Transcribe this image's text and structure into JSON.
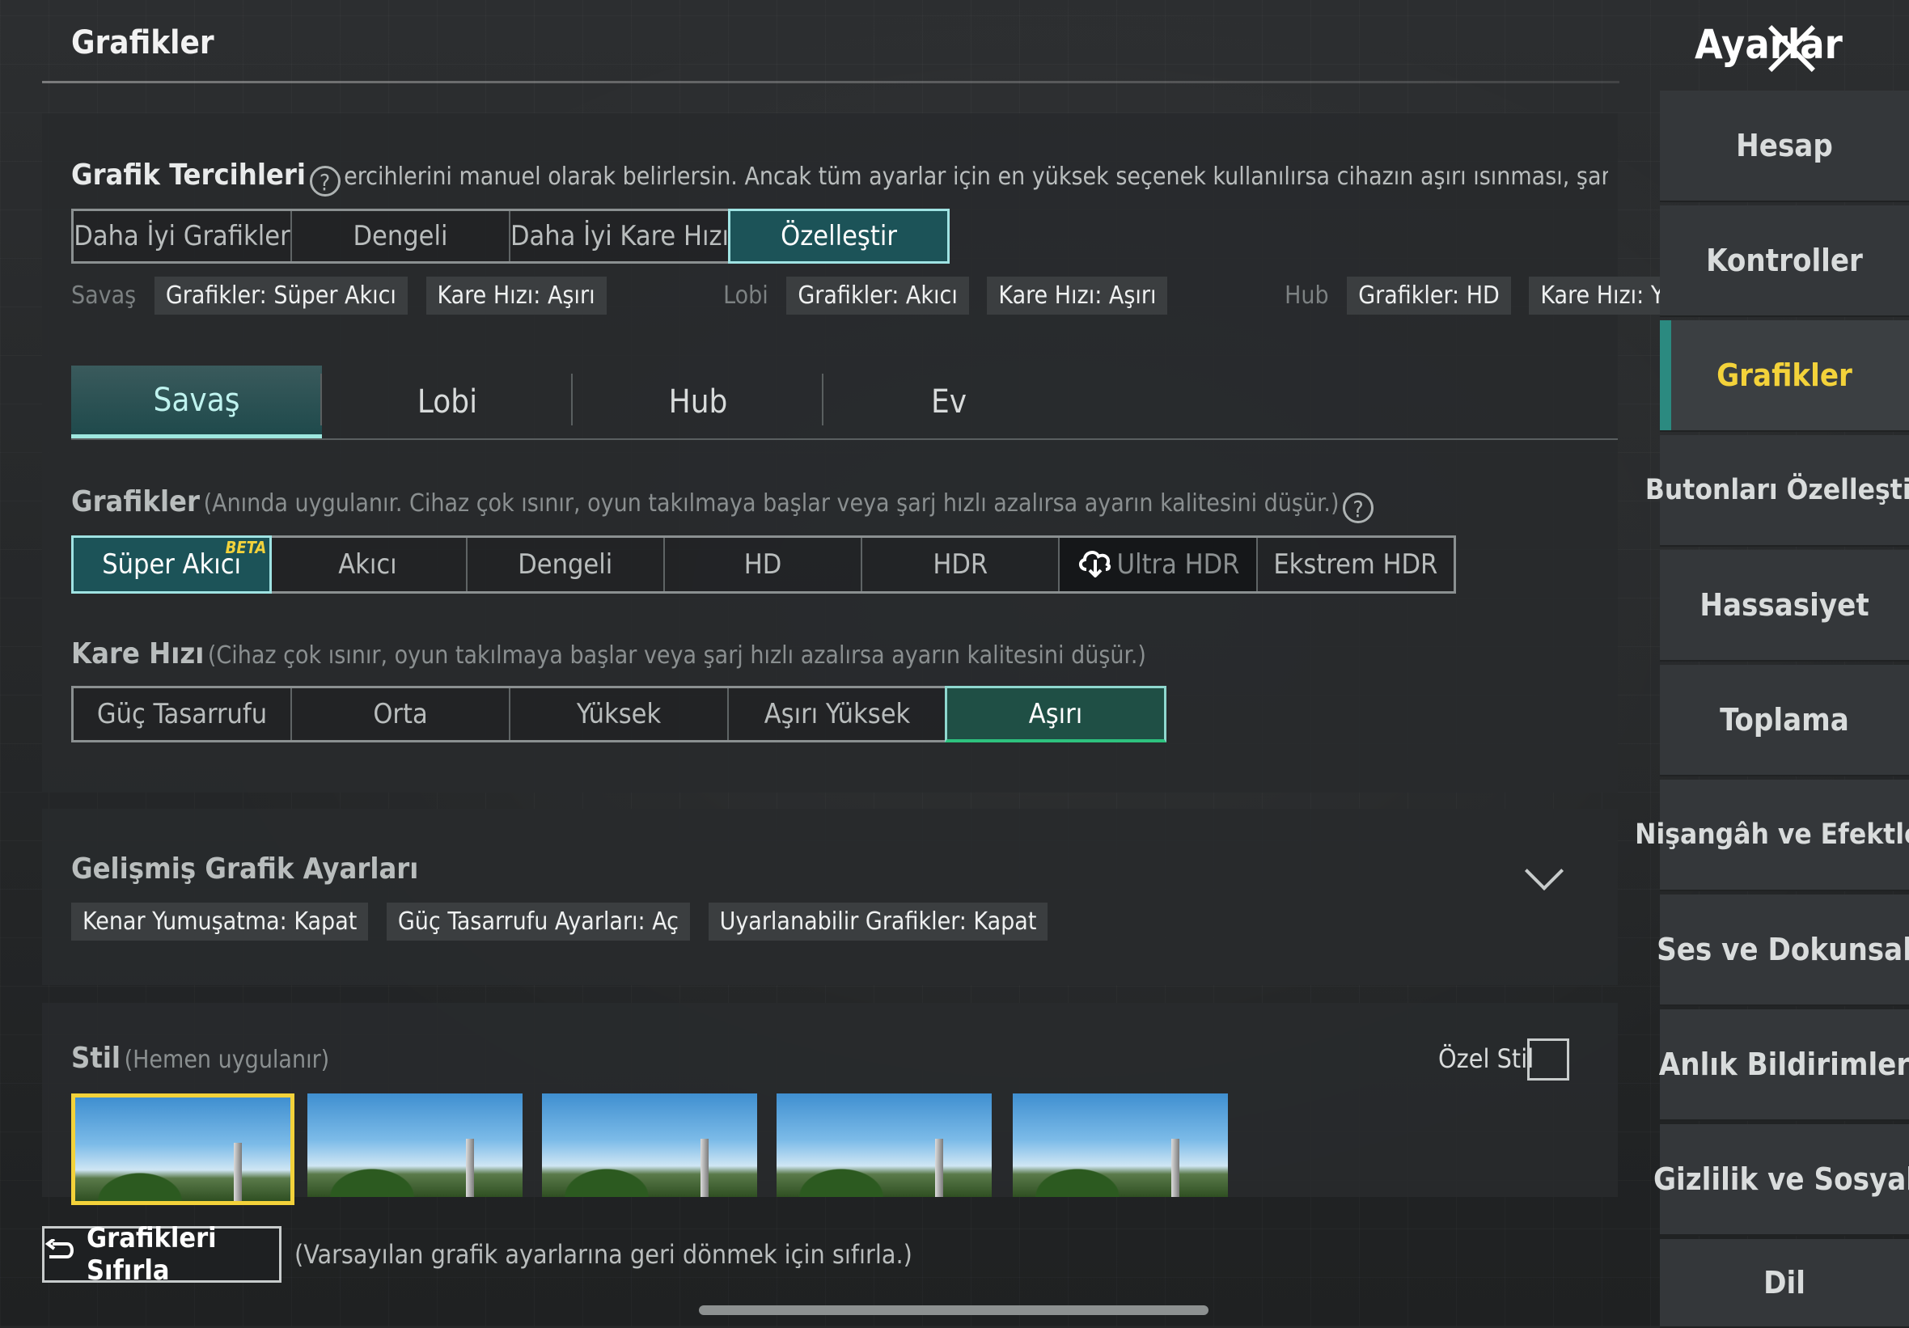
{
  "header": {
    "title": "Grafikler",
    "settings_title": "Ayarlar"
  },
  "preferences": {
    "label": "Grafik Tercihleri",
    "description": "ercihlerini manuel olarak belirlersin. Ancak tüm ayarlar için en yüksek seçenek kullanılırsa cihazın aşırı ısınması, şarj tüketiminin artma",
    "options": [
      "Daha İyi Grafikler",
      "Dengeli",
      "Daha İyi Kare Hızı",
      "Özelleştir"
    ],
    "selected": "Özelleştir",
    "summary": [
      {
        "label": "Savaş",
        "chips": [
          "Grafikler: Süper Akıcı",
          "Kare Hızı: Aşırı"
        ]
      },
      {
        "label": "Lobi",
        "chips": [
          "Grafikler: Akıcı",
          "Kare Hızı: Aşırı"
        ]
      },
      {
        "label": "Hub",
        "chips": [
          "Grafikler: HD",
          "Kare Hızı: Yüksek"
        ]
      }
    ]
  },
  "tabs": [
    "Savaş",
    "Lobi",
    "Hub",
    "Ev"
  ],
  "graphics": {
    "label": "Grafikler",
    "note": "(Anında uygulanır. Cihaz çok ısınır, oyun takılmaya başlar veya şarj hızlı azalırsa ayarın kalitesini düşür.)",
    "options": [
      "Süper Akıcı",
      "Akıcı",
      "Dengeli",
      "HD",
      "HDR",
      "Ultra HDR",
      "Ekstrem HDR"
    ],
    "beta_badge": "BETA"
  },
  "frame_rate": {
    "label": "Kare Hızı",
    "note": "(Cihaz çok ısınır, oyun takılmaya başlar veya şarj hızlı azalırsa ayarın kalitesini düşür.)",
    "options": [
      "Güç Tasarrufu",
      "Orta",
      "Yüksek",
      "Aşırı Yüksek",
      "Aşırı"
    ]
  },
  "advanced": {
    "label": "Gelişmiş Grafik Ayarları",
    "chips": [
      "Kenar Yumuşatma: Kapat",
      "Güç Tasarrufu Ayarları: Aç",
      "Uyarlanabilir Grafikler: Kapat"
    ]
  },
  "style": {
    "label": "Stil",
    "note": "(Hemen uygulanır)",
    "custom_label": "Özel Stil"
  },
  "footer": {
    "reset_label": "Grafikleri Sıfırla",
    "reset_note": "(Varsayılan grafik ayarlarına geri dönmek için sıfırla.)"
  },
  "sidebar": {
    "items": [
      "Hesap",
      "Kontroller",
      "Grafikler",
      "Butonları Özelleştir",
      "Hassasiyet",
      "Toplama",
      "Nişangâh ve Efektler",
      "Ses ve Dokunsal",
      "Anlık Bildirimler",
      "Gizlilik ve Sosyal",
      "Dil"
    ],
    "active": "Grafikler"
  },
  "colors": {
    "accent_teal": "#9fe3e3",
    "active_yellow": "#f3d23a",
    "selection_green": "#2ec27e"
  }
}
